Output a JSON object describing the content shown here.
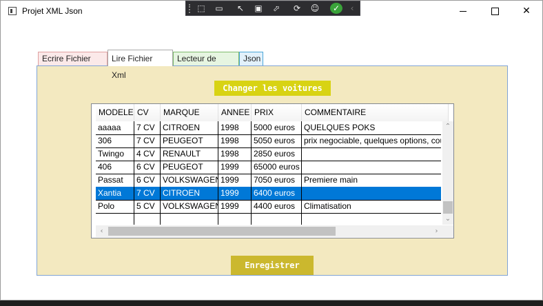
{
  "window": {
    "title": "Projet XML Json"
  },
  "debug_toolbar": {
    "icons": [
      "select-element-icon",
      "video-icon",
      "pointer-icon",
      "frame-icon",
      "inspect-icon",
      "hot-reload-icon",
      "accessibility-icon",
      "check-icon",
      "collapse-icon"
    ]
  },
  "tabs": [
    {
      "label": "Ecrire Fichier Xml",
      "color": "#fbe9e9"
    },
    {
      "label": "Lire Fichier Xml",
      "selected": true
    },
    {
      "label": "Lecteur de texte",
      "color": "#e6f5e1"
    },
    {
      "label": "Json",
      "color": "#e2f1fb"
    }
  ],
  "panel": {
    "change_button": "Changer les voitures",
    "save_button": "Enregistrer",
    "accent": "#d8d313"
  },
  "grid": {
    "columns": [
      "MODELE",
      "CV",
      "MARQUE",
      "ANNEE",
      "PRIX",
      "COMMENTAIRE"
    ],
    "rows": [
      [
        "aaaaa",
        "7 CV",
        "CITROEN",
        "1998",
        "5000 euros",
        "QUELQUES POKS"
      ],
      [
        "306",
        "7 CV",
        "PEUGEOT",
        "1998",
        "5050 euros",
        "prix negociable, quelques options, cou"
      ],
      [
        "Twingo",
        "4 CV",
        "RENAULT",
        "1998",
        "2850 euros",
        ""
      ],
      [
        "406",
        "6 CV",
        "PEUGEOT",
        "1999",
        "65000 euros",
        ""
      ],
      [
        "Passat",
        "6 CV",
        "VOLKSWAGEN",
        "1999",
        "7050 euros",
        "Premiere main"
      ],
      [
        "Xantia",
        "7 CV",
        "CITROEN",
        "1999",
        "6400 euros",
        ""
      ],
      [
        "Polo",
        "5 CV",
        "VOLKSWAGEN",
        "1999",
        "4400 euros",
        "Climatisation"
      ],
      [
        "",
        "",
        "",
        "",
        "",
        ""
      ]
    ],
    "selected_row": 5,
    "selection_color": "#0078d7"
  }
}
